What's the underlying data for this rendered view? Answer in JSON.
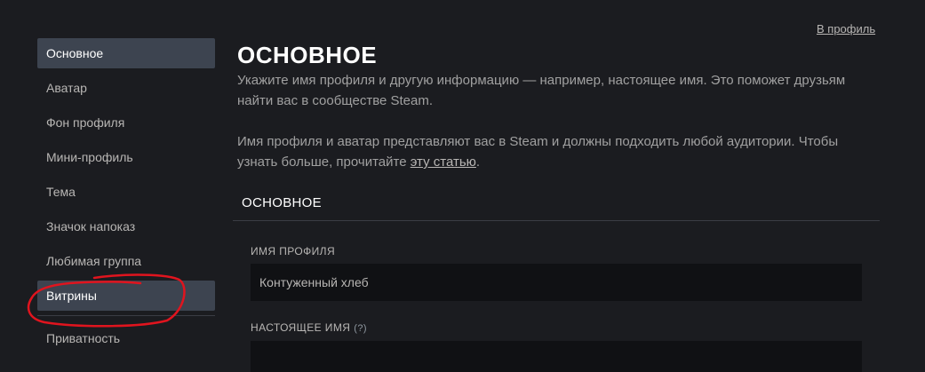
{
  "header": {
    "profile_link": "В профиль"
  },
  "sidebar": {
    "items": [
      {
        "label": "Основное"
      },
      {
        "label": "Аватар"
      },
      {
        "label": "Фон профиля"
      },
      {
        "label": "Мини-профиль"
      },
      {
        "label": "Тема"
      },
      {
        "label": "Значок напоказ"
      },
      {
        "label": "Любимая группа"
      },
      {
        "label": "Витрины"
      },
      {
        "label": "Приватность"
      }
    ]
  },
  "main": {
    "title": "ОСНОВНОЕ",
    "desc1": "Укажите имя профиля и другую информацию — например, настоящее имя. Это поможет друзьям найти вас в сообществе Steam.",
    "desc2_before": "Имя профиля и аватар представляют вас в Steam и должны подходить любой аудитории. Чтобы узнать больше, прочитайте ",
    "desc2_link": "эту статью",
    "desc2_after": ".",
    "section_title": "ОСНОВНОЕ",
    "fields": {
      "profile_name_label": "Имя профиля",
      "profile_name_value": "Контуженный хлеб",
      "real_name_label": "Настоящее имя",
      "real_name_help": "(?)",
      "real_name_value": ""
    }
  },
  "colors": {
    "background": "#1b1c20",
    "active_item": "#3d4450",
    "input_bg": "#101114",
    "annotation": "#e0141e"
  }
}
